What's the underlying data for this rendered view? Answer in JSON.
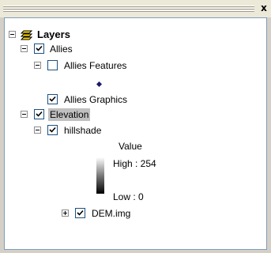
{
  "window": {
    "close_glyph": "x"
  },
  "toc": {
    "root": {
      "label": "Layers",
      "icon": "layers-icon",
      "expanded": true
    },
    "layers": [
      {
        "label": "Allies",
        "checked": true,
        "expanded": true,
        "sublayers": [
          {
            "label": "Allies Features",
            "checked": false,
            "expanded": true,
            "symbol": "diamond-point",
            "symbol_color": "#1a1a6b"
          },
          {
            "label": "Allies Graphics",
            "checked": true
          }
        ]
      },
      {
        "label": "Elevation",
        "checked": true,
        "expanded": true,
        "selected": true,
        "sublayers": [
          {
            "label": "hillshade",
            "checked": true,
            "expanded": true,
            "legend": {
              "heading": "Value",
              "high": "High : 254",
              "low": "Low : 0"
            }
          },
          {
            "label": "DEM.img",
            "checked": true,
            "expanded": false
          }
        ]
      }
    ]
  }
}
